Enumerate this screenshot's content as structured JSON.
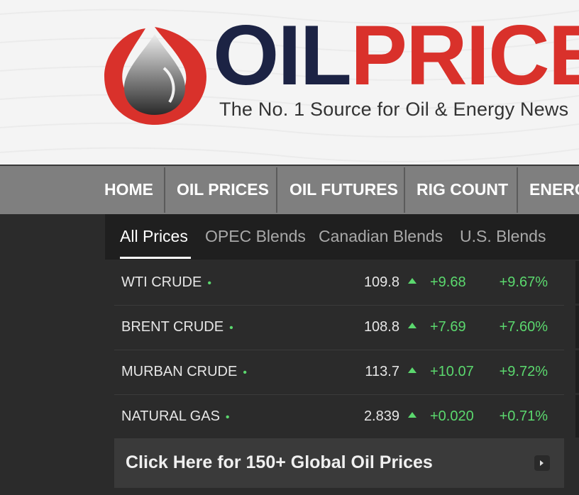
{
  "header": {
    "brand_oil": "OIL",
    "brand_price": "PRICE",
    "tagline": "The No. 1 Source for Oil & Energy News"
  },
  "nav": {
    "items": [
      "HOME",
      "OIL PRICES",
      "OIL FUTURES",
      "RIG COUNT",
      "ENERGY"
    ]
  },
  "tabs": [
    "All Prices",
    "OPEC Blends",
    "Canadian Blends",
    "U.S. Blends"
  ],
  "prices": [
    {
      "name": "WTI CRUDE",
      "price": "109.8",
      "change": "+9.68",
      "pct": "+9.67%"
    },
    {
      "name": "BRENT CRUDE",
      "price": "108.8",
      "change": "+7.69",
      "pct": "+7.60%"
    },
    {
      "name": "MURBAN CRUDE",
      "price": "113.7",
      "change": "+10.07",
      "pct": "+9.72%"
    },
    {
      "name": "NATURAL GAS",
      "price": "2.839",
      "change": "+0.020",
      "pct": "+0.71%"
    }
  ],
  "cta": {
    "label": "Click Here for 150+ Global Oil Prices"
  },
  "colors": {
    "brand_navy": "#1c2344",
    "brand_red": "#d9312b",
    "up_green": "#5bd86e"
  }
}
